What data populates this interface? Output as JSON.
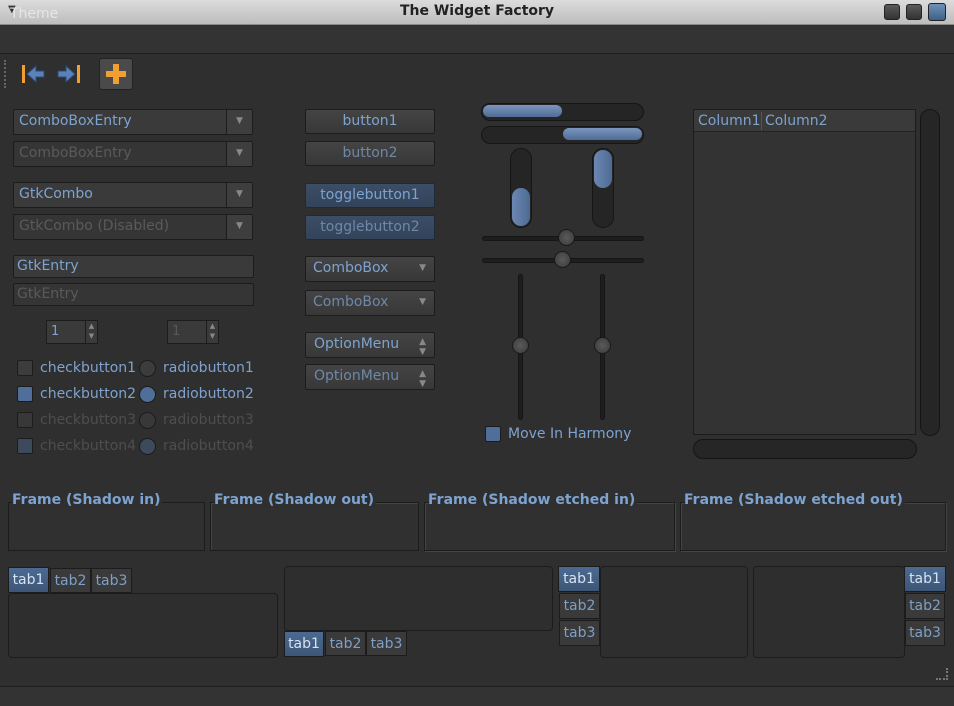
{
  "window": {
    "title": "The Widget Factory"
  },
  "menubar": {
    "theme": "Theme"
  },
  "colors": {
    "accent": "#7da3d0",
    "toolbar_icon": "#f0a030"
  },
  "combobox_entries": {
    "e1": "ComboBoxEntry",
    "e2": "ComboBoxEntry",
    "gtk1": "GtkCombo",
    "gtk2": "GtkCombo (Disabled)"
  },
  "entries": {
    "e1": "GtkEntry",
    "e2": "GtkEntry"
  },
  "spinners": {
    "s1": "1",
    "s2": "1"
  },
  "checks": [
    "checkbutton1",
    "checkbutton2",
    "checkbutton3",
    "checkbutton4"
  ],
  "radios": [
    "radiobutton1",
    "radiobutton2",
    "radiobutton3",
    "radiobutton4"
  ],
  "buttons": {
    "b1": "button1",
    "b2": "button2",
    "t1": "togglebutton1",
    "t2": "togglebutton2",
    "cb1": "ComboBox",
    "cb2": "ComboBox",
    "om1": "OptionMenu",
    "om2": "OptionMenu"
  },
  "progress": {
    "h1": 0.5,
    "h2": 0.5,
    "v1": 0.5,
    "v2": 0.5
  },
  "harmony": "Move In Harmony",
  "tree": {
    "columns": [
      "Column1",
      "Column2"
    ]
  },
  "frames": [
    "Frame (Shadow in)",
    "Frame (Shadow out)",
    "Frame (Shadow etched in)",
    "Frame (Shadow etched out)"
  ],
  "tabs": [
    "tab1",
    "tab2",
    "tab3"
  ]
}
